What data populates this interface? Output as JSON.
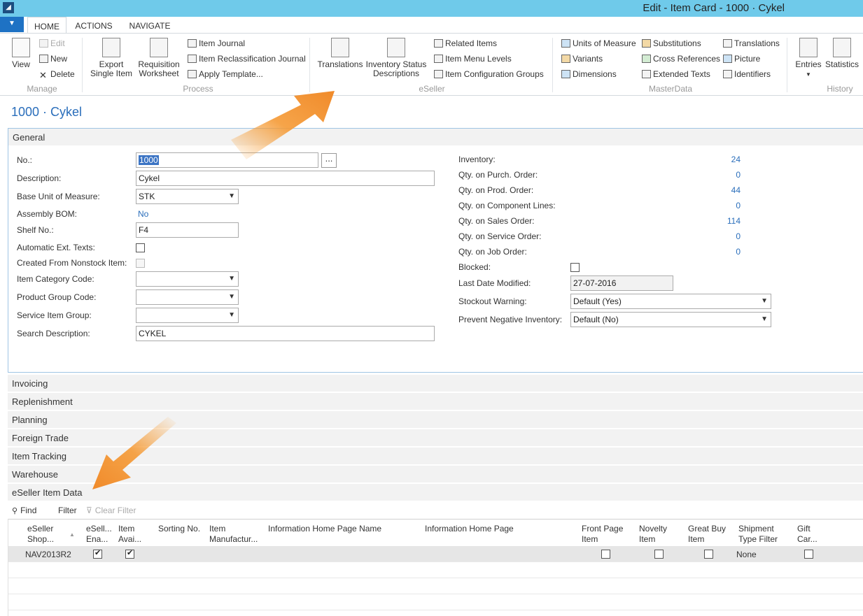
{
  "window": {
    "title": "Edit - Item Card - 1000 · Cykel",
    "logo": "nav-logo-icon"
  },
  "tabs": [
    {
      "label": "HOME",
      "active": true
    },
    {
      "label": "ACTIONS",
      "active": false
    },
    {
      "label": "NAVIGATE",
      "active": false
    }
  ],
  "ribbon": {
    "manage": {
      "label": "Manage",
      "view": "View",
      "edit": "Edit",
      "new": "New",
      "delete": "Delete"
    },
    "process": {
      "label": "Process",
      "export1": "Export",
      "export2": "Single Item",
      "req1": "Requisition",
      "req2": "Worksheet",
      "item_journal": "Item Journal",
      "item_reclass": "Item Reclassification Journal",
      "apply_template": "Apply Template..."
    },
    "eseller": {
      "label": "eSeller",
      "translations": "Translations",
      "inv1": "Inventory Status",
      "inv2": "Descriptions",
      "related": "Related Items",
      "menu_levels": "Item Menu Levels",
      "config_groups": "Item Configuration Groups"
    },
    "masterdata": {
      "label": "MasterData",
      "units": "Units of Measure",
      "variants": "Variants",
      "dimensions": "Dimensions",
      "substitutions": "Substitutions",
      "cross_refs": "Cross References",
      "ext_texts": "Extended Texts",
      "translations": "Translations",
      "picture": "Picture",
      "identifiers": "Identifiers"
    },
    "history": {
      "label": "History",
      "entries": "Entries",
      "statistics": "Statistics"
    }
  },
  "page_title": "1000 · Cykel",
  "general": {
    "header": "General",
    "left": {
      "no_label": "No.:",
      "no_value": "1000",
      "description_label": "Description:",
      "description_value": "Cykel",
      "base_uom_label": "Base Unit of Measure:",
      "base_uom_value": "STK",
      "assembly_bom_label": "Assembly BOM:",
      "assembly_bom_value": "No",
      "shelf_label": "Shelf No.:",
      "shelf_value": "F4",
      "auto_ext_label": "Automatic Ext. Texts:",
      "nonstock_label": "Created From Nonstock Item:",
      "item_cat_label": "Item Category Code:",
      "prod_group_label": "Product Group Code:",
      "service_group_label": "Service Item Group:",
      "search_desc_label": "Search Description:",
      "search_desc_value": "CYKEL"
    },
    "right": {
      "inventory_label": "Inventory:",
      "inventory_value": "24",
      "purch_label": "Qty. on Purch. Order:",
      "purch_value": "0",
      "prod_label": "Qty. on Prod. Order:",
      "prod_value": "44",
      "component_label": "Qty. on Component Lines:",
      "component_value": "0",
      "sales_label": "Qty. on Sales Order:",
      "sales_value": "114",
      "service_label": "Qty. on Service Order:",
      "service_value": "0",
      "job_label": "Qty. on Job Order:",
      "job_value": "0",
      "blocked_label": "Blocked:",
      "last_modified_label": "Last Date Modified:",
      "last_modified_value": "27-07-2016",
      "stockout_label": "Stockout Warning:",
      "stockout_value": "Default (Yes)",
      "prevent_neg_label": "Prevent Negative Inventory:",
      "prevent_neg_value": "Default (No)"
    }
  },
  "fasttabs": [
    "Invoicing",
    "Replenishment",
    "Planning",
    "Foreign Trade",
    "Item Tracking",
    "Warehouse",
    "eSeller Item Data"
  ],
  "subpage": {
    "find": "Find",
    "filter": "Filter",
    "clear_filter": "Clear Filter",
    "columns": [
      {
        "l1": "eSeller",
        "l2": "Shop..."
      },
      {
        "l1": "eSell...",
        "l2": "Ena..."
      },
      {
        "l1": "Item",
        "l2": "Avai..."
      },
      {
        "l1": "Sorting No.",
        "l2": ""
      },
      {
        "l1": "Item",
        "l2": "Manufactur..."
      },
      {
        "l1": "Information Home Page Name",
        "l2": ""
      },
      {
        "l1": "Information Home Page",
        "l2": ""
      },
      {
        "l1": "Front Page",
        "l2": "Item"
      },
      {
        "l1": "Novelty",
        "l2": "Item"
      },
      {
        "l1": "Great Buy",
        "l2": "Item"
      },
      {
        "l1": "Shipment",
        "l2": "Type Filter"
      },
      {
        "l1": "Gift",
        "l2": "Car..."
      }
    ],
    "row": {
      "shop": "NAV2013R2",
      "shipment_filter": "None"
    }
  },
  "accent": "#2a6ebb",
  "titlebar_color": "#6fcaea"
}
